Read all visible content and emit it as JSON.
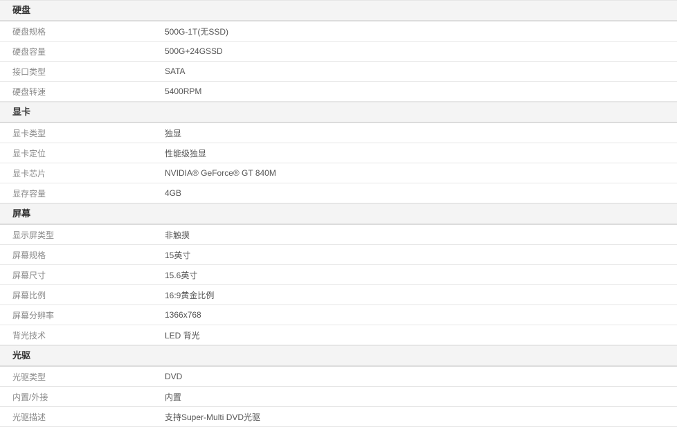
{
  "sections": [
    {
      "title": "硬盘",
      "rows": [
        {
          "label": "硬盘规格",
          "value": "500G-1T(无SSD)"
        },
        {
          "label": "硬盘容量",
          "value": "500G+24GSSD"
        },
        {
          "label": "接口类型",
          "value": "SATA"
        },
        {
          "label": "硬盘转速",
          "value": "5400RPM"
        }
      ]
    },
    {
      "title": "显卡",
      "rows": [
        {
          "label": "显卡类型",
          "value": "独显"
        },
        {
          "label": "显卡定位",
          "value": "性能级独显"
        },
        {
          "label": "显卡芯片",
          "value": "NVIDIA® GeForce® GT 840M"
        },
        {
          "label": "显存容量",
          "value": "4GB"
        }
      ]
    },
    {
      "title": "屏幕",
      "rows": [
        {
          "label": "显示屏类型",
          "value": "非触摸"
        },
        {
          "label": "屏幕规格",
          "value": "15英寸"
        },
        {
          "label": "屏幕尺寸",
          "value": "15.6英寸"
        },
        {
          "label": "屏幕比例",
          "value": "16:9黄金比例"
        },
        {
          "label": "屏幕分辨率",
          "value": "1366x768"
        },
        {
          "label": "背光技术",
          "value": "LED 背光"
        }
      ]
    },
    {
      "title": "光驱",
      "rows": [
        {
          "label": "光驱类型",
          "value": "DVD"
        },
        {
          "label": "内置/外接",
          "value": "内置"
        },
        {
          "label": "光驱描述",
          "value": "支持Super-Multi DVD光驱"
        }
      ]
    }
  ]
}
